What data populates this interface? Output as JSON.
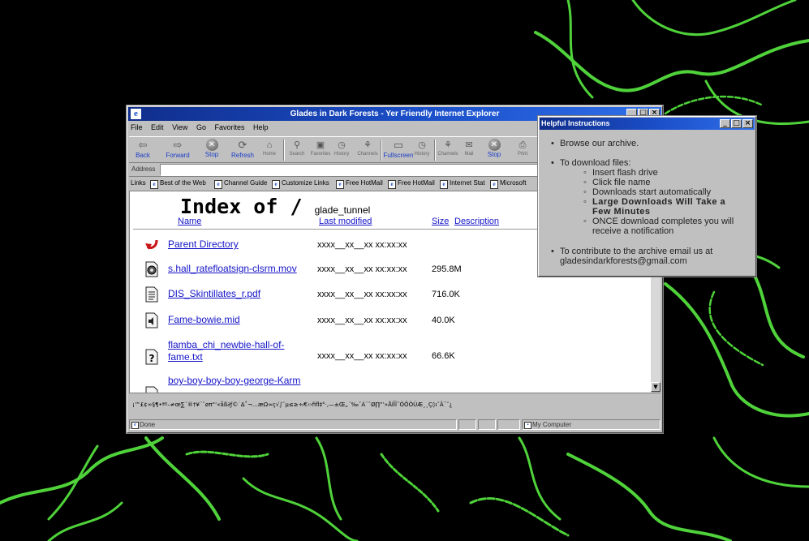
{
  "browser": {
    "title": "Glades in Dark Forests - Yer Friendly Internet Explorer",
    "ie_logo": "e",
    "window_buttons": [
      "_",
      "□",
      "×"
    ],
    "menu": [
      "File",
      "Edit",
      "View",
      "Go",
      "Favorites",
      "Help"
    ],
    "toolbar": {
      "back": "Back",
      "forward": "Forward",
      "stop": "Stop",
      "refresh": "Refresh",
      "home": "Home",
      "search": "Search",
      "favorites": "Favorites",
      "history": "History",
      "channels": "Channels",
      "fullscreen": "Fullscreen",
      "history2": "History",
      "channels2": "Channels",
      "mail": "Mail",
      "stop2": "Stop",
      "print": "Print"
    },
    "address_label": "Address",
    "address_value": "",
    "links_label": "Links",
    "links": [
      "Best of the Web",
      "Channel Guide",
      "Customize Links",
      "Free HotMail",
      "Free HotMail",
      "Internet Stat",
      "Microsoft"
    ],
    "status_text": "Done",
    "zone_text": "My Computer",
    "garbled_text": "¡™£¢∞§¶•ªº–≠œ∑´®†¥¨ˆøπ“‘«åß∂ƒ©˙∆˚¬…æΩ≈ç√∫˜µ≤≥÷⁄€‹›ﬁﬂ‡°·‚—±Œ„´‰ˇÁ¨ˆØ∏”’»ÅÍÎÏ˝ÓÔÒÚÆ¸˛Ç◊ı˜Â¯˘¿"
  },
  "index": {
    "heading": "Index of /",
    "dir": "glade_tunnel",
    "columns": {
      "name": "Name",
      "modified": "Last modified",
      "size": "Size",
      "description": "Description"
    },
    "rows": [
      {
        "icon": "back-arrow-icon",
        "name": "Parent Directory",
        "modified": "xxxx__xx__xx xx:xx:xx",
        "size": ""
      },
      {
        "icon": "movie-file-icon",
        "name": "s.hall_ratefloatsign-clsrm.mov",
        "modified": "xxxx__xx__xx xx:xx:xx",
        "size": "295.8M"
      },
      {
        "icon": "text-file-icon",
        "name": "DIS_Skintillates_r.pdf",
        "modified": "xxxx__xx__xx xx:xx:xx",
        "size": "716.0K"
      },
      {
        "icon": "sound-file-icon",
        "name": "Fame-bowie.mid",
        "modified": "xxxx__xx__xx xx:xx:xx",
        "size": "40.0K"
      },
      {
        "icon": "unknown-file-icon",
        "name": "flamba_chi_newbie-hall-of-fame.txt",
        "modified": "xxxx__xx__xx xx:xx:xx",
        "size": "66.6K"
      },
      {
        "icon": "text-file-icon",
        "name": "boy-boy-boy-boy-george-Karm",
        "modified": "",
        "size": ""
      }
    ]
  },
  "help": {
    "title": "Helpful Instructions",
    "items": [
      "Browse our archive.",
      "To download files:",
      "To contribute to the archive email us at gladesindarkforests@gmail.com"
    ],
    "download_steps": [
      "Insert flash drive",
      "Click file name",
      "Downloads start automatically",
      "Large Downloads Will Take a Few Minutes",
      "ONCE download completes you will receive a notification"
    ]
  },
  "colors": {
    "link": "#1414c8",
    "titlebar": "#1b4fc9",
    "chrome": "#c0c0c0",
    "background_vines": "#4fd23a"
  }
}
